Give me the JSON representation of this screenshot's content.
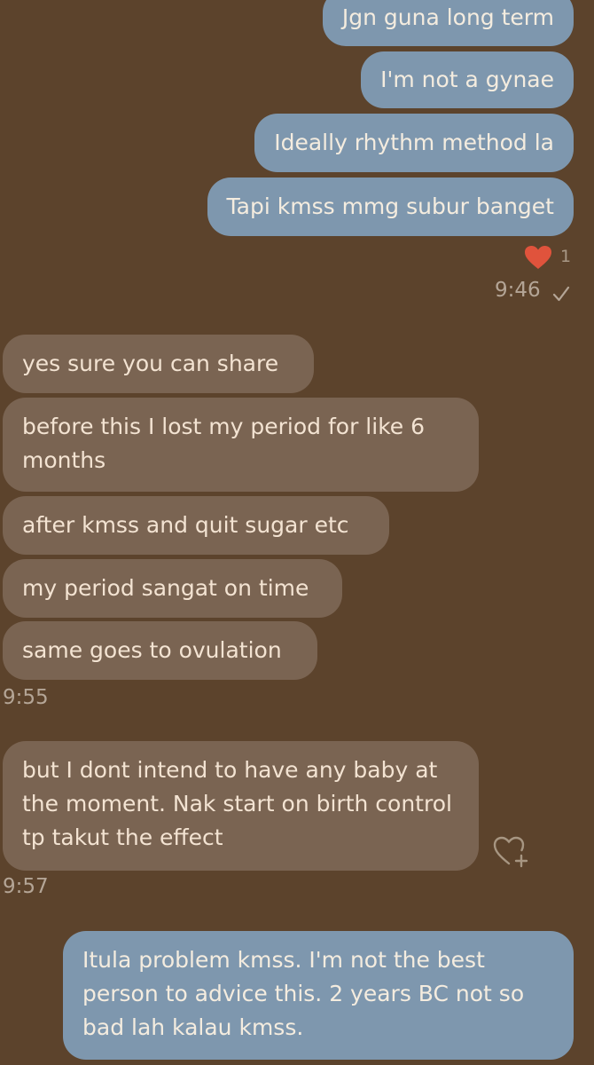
{
  "chat": {
    "outgoing_top": [
      "Jgn guna long term",
      "I'm not a gynae",
      "Ideally rhythm method la",
      "Tapi kmss mmg subur banget"
    ],
    "reaction_count": "1",
    "time_outgoing_top": "9:46",
    "incoming_group1": [
      "yes sure you can share",
      "before this I lost my period for like 6 months",
      "after kmss and quit sugar etc",
      "my period sangat on time",
      "same goes to ovulation"
    ],
    "time_incoming_group1": "9:55",
    "incoming_group2": [
      "but I dont intend to have any baby at the moment. Nak start on birth control tp takut the effect"
    ],
    "time_incoming_group2": "9:57",
    "outgoing_bottom": [
      "Itula problem kmss. I'm not the best person to advice this. 2 years BC not so bad lah kalau kmss."
    ]
  },
  "colors": {
    "background": "#5c432c",
    "outgoing_bubble": "#7e97ae",
    "incoming_bubble": "#7a6452",
    "heart": "#e0533c"
  },
  "icons": {
    "reaction": "red-heart-icon",
    "read_receipt": "checkmark-icon",
    "add_reaction": "heart-plus-icon"
  }
}
